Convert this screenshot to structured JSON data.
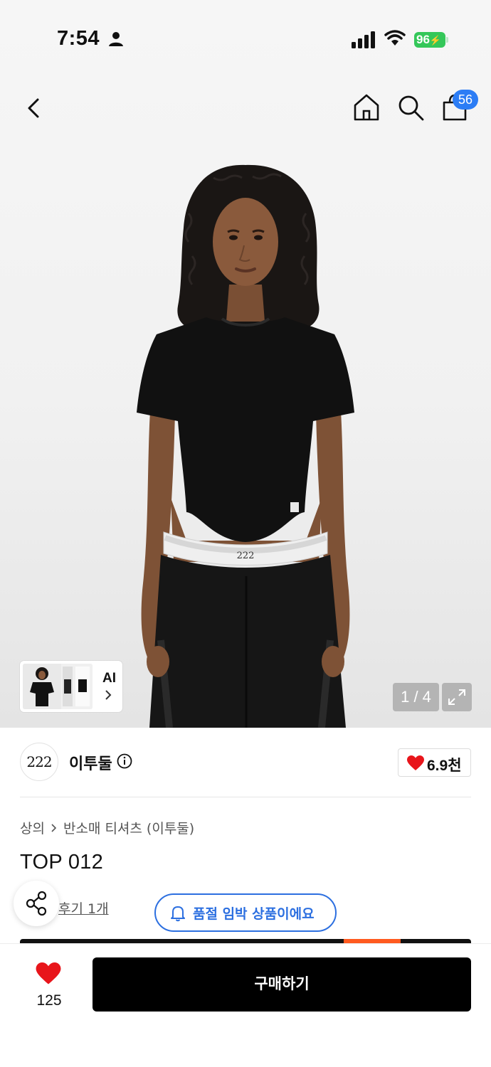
{
  "status_bar": {
    "time": "7:54",
    "battery": "96",
    "icons": [
      "person-icon",
      "signal-icon",
      "wifi-icon",
      "battery-icon"
    ]
  },
  "nav": {
    "icons": [
      "back-icon",
      "home-icon",
      "search-icon",
      "cart-icon"
    ],
    "cart_count": "56"
  },
  "gallery": {
    "ai_label": "AI",
    "page_indicator": "1 / 4"
  },
  "brand": {
    "logo_text": "222",
    "name": "이투둘",
    "likes": "6.9천"
  },
  "product": {
    "breadcrumb": [
      "상의",
      "반소매 티셔츠 (이투둘)"
    ],
    "title": "TOP 012",
    "review_link": "후기 1개",
    "soldout_notice": "품절 임박 상품이에요"
  },
  "bottom_bar": {
    "wish_count": "125",
    "buy_label": "구매하기"
  },
  "colors": {
    "accent_blue": "#2c6fe0",
    "badge_blue": "#2c7df5",
    "heart_red": "#e8151b",
    "battery_green": "#34c759",
    "buy_button": "#000000"
  }
}
